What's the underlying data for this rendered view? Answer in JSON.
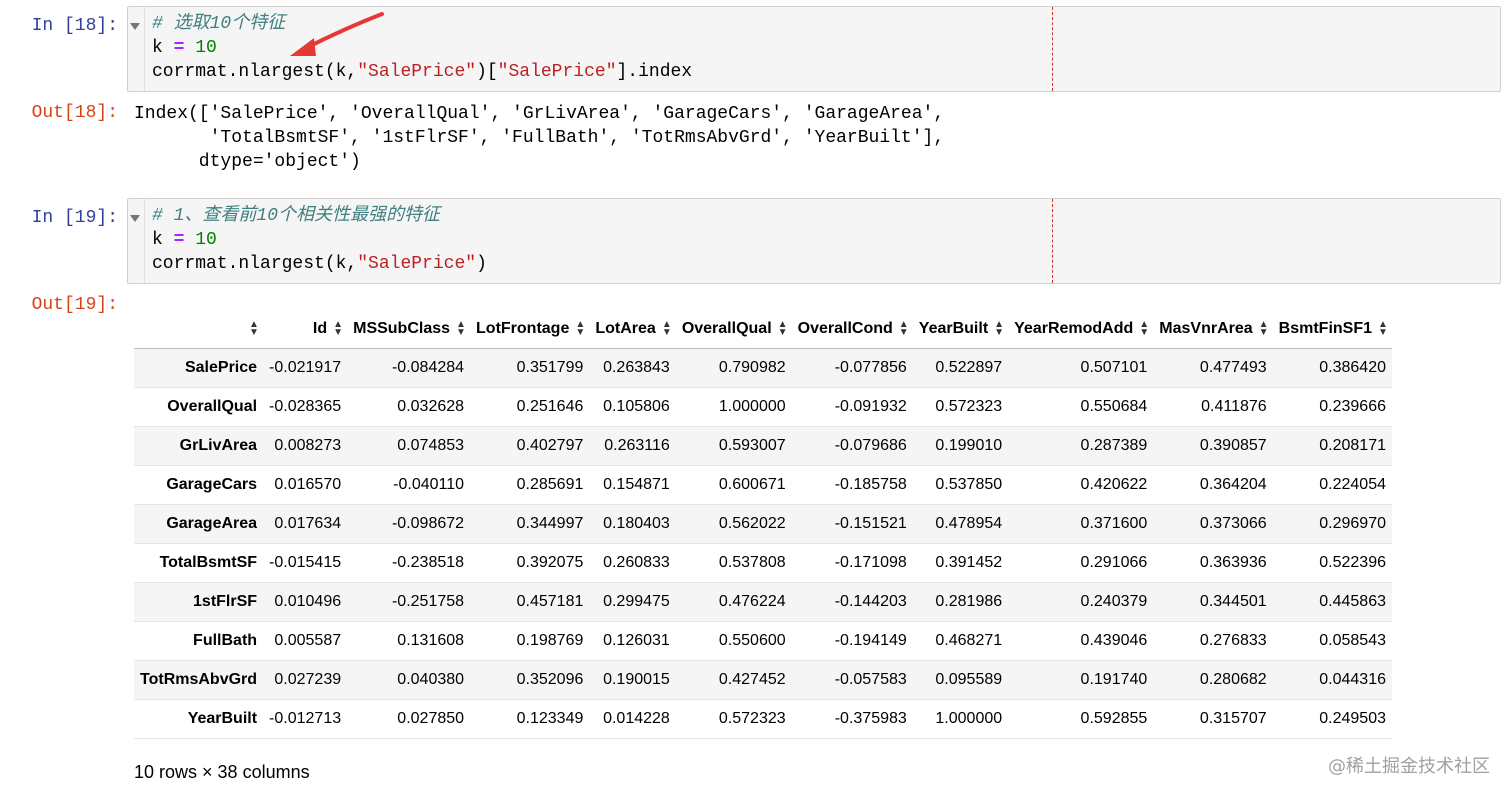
{
  "cells": [
    {
      "in_prompt": "In [18]:",
      "code_lines": {
        "line1_comment": "# 选取10个特征",
        "line2_var": "k",
        "line2_op": "=",
        "line2_num": "10",
        "line3_pre": "corrmat.nlargest(k,",
        "line3_str1": "\"SalePrice\"",
        "line3_mid": ")[",
        "line3_str2": "\"SalePrice\"",
        "line3_post": "].index"
      },
      "out_prompt": "Out[18]:",
      "output_text": "Index(['SalePrice', 'OverallQual', 'GrLivArea', 'GarageCars', 'GarageArea',\n       'TotalBsmtSF', '1stFlrSF', 'FullBath', 'TotRmsAbvGrd', 'YearBuilt'],\n      dtype='object')"
    },
    {
      "in_prompt": "In [19]:",
      "code_lines": {
        "line1_comment": "# 1、查看前10个相关性最强的特征",
        "line2_var": "k",
        "line2_op": "=",
        "line2_num": "10",
        "line3_pre": "corrmat.nlargest(k,",
        "line3_str1": "\"SalePrice\"",
        "line3_post": ")"
      },
      "out_prompt": "Out[19]:"
    }
  ],
  "dataframe": {
    "columns": [
      "Id",
      "MSSubClass",
      "LotFrontage",
      "LotArea",
      "OverallQual",
      "OverallCond",
      "YearBuilt",
      "YearRemodAdd",
      "MasVnrArea",
      "BsmtFinSF1"
    ],
    "rows": [
      {
        "index": "SalePrice",
        "values": [
          "-0.021917",
          "-0.084284",
          "0.351799",
          "0.263843",
          "0.790982",
          "-0.077856",
          "0.522897",
          "0.507101",
          "0.477493",
          "0.386420"
        ]
      },
      {
        "index": "OverallQual",
        "values": [
          "-0.028365",
          "0.032628",
          "0.251646",
          "0.105806",
          "1.000000",
          "-0.091932",
          "0.572323",
          "0.550684",
          "0.411876",
          "0.239666"
        ]
      },
      {
        "index": "GrLivArea",
        "values": [
          "0.008273",
          "0.074853",
          "0.402797",
          "0.263116",
          "0.593007",
          "-0.079686",
          "0.199010",
          "0.287389",
          "0.390857",
          "0.208171"
        ]
      },
      {
        "index": "GarageCars",
        "values": [
          "0.016570",
          "-0.040110",
          "0.285691",
          "0.154871",
          "0.600671",
          "-0.185758",
          "0.537850",
          "0.420622",
          "0.364204",
          "0.224054"
        ]
      },
      {
        "index": "GarageArea",
        "values": [
          "0.017634",
          "-0.098672",
          "0.344997",
          "0.180403",
          "0.562022",
          "-0.151521",
          "0.478954",
          "0.371600",
          "0.373066",
          "0.296970"
        ]
      },
      {
        "index": "TotalBsmtSF",
        "values": [
          "-0.015415",
          "-0.238518",
          "0.392075",
          "0.260833",
          "0.537808",
          "-0.171098",
          "0.391452",
          "0.291066",
          "0.363936",
          "0.522396"
        ]
      },
      {
        "index": "1stFlrSF",
        "values": [
          "0.010496",
          "-0.251758",
          "0.457181",
          "0.299475",
          "0.476224",
          "-0.144203",
          "0.281986",
          "0.240379",
          "0.344501",
          "0.445863"
        ]
      },
      {
        "index": "FullBath",
        "values": [
          "0.005587",
          "0.131608",
          "0.198769",
          "0.126031",
          "0.550600",
          "-0.194149",
          "0.468271",
          "0.439046",
          "0.276833",
          "0.058543"
        ]
      },
      {
        "index": "TotRmsAbvGrd",
        "values": [
          "0.027239",
          "0.040380",
          "0.352096",
          "0.190015",
          "0.427452",
          "-0.057583",
          "0.095589",
          "0.191740",
          "0.280682",
          "0.044316"
        ]
      },
      {
        "index": "YearBuilt",
        "values": [
          "-0.012713",
          "0.027850",
          "0.123349",
          "0.014228",
          "0.572323",
          "-0.375983",
          "1.000000",
          "0.592855",
          "0.315707",
          "0.249503"
        ]
      }
    ],
    "shape_text": "10 rows × 38 columns"
  },
  "watermark": "@稀土掘金技术社区",
  "colors": {
    "in_prompt": "#303f9f",
    "out_prompt": "#d84315",
    "arrow": "#e53935",
    "ruler": "#d32f2f"
  },
  "icons": [
    "sort-icon",
    "collapse-triangle-icon",
    "red-arrow-annotation"
  ]
}
